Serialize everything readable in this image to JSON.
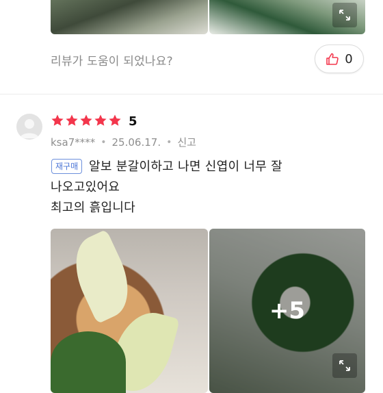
{
  "previous_review": {
    "helpful_question": "리뷰가 도움이 되었나요?",
    "helpful_count": "0"
  },
  "review": {
    "rating": "5",
    "stars": 5,
    "username": "ksa7****",
    "date": "25.06.17.",
    "report_label": "신고",
    "badge": "재구매",
    "text_line_1": "알보 분갈이하고 나면 신엽이 너무 잘",
    "text_line_2": "나오고있어요",
    "text_line_3": "최고의 흙입니다",
    "more_photos_label": "+5"
  },
  "colors": {
    "star": "#f3364c",
    "like_icon": "#f3364c",
    "badge_border": "#6c8fdc",
    "badge_text": "#4a74d6"
  },
  "icons": {
    "like": "thumbs-up-icon",
    "expand": "expand-icon",
    "star": "star-icon"
  }
}
